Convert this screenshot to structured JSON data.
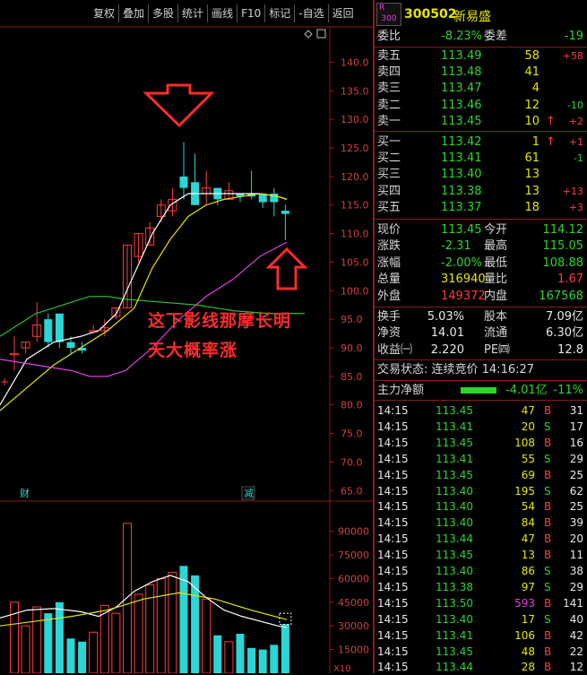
{
  "toolbar": {
    "items": [
      "复权",
      "叠加",
      "多股",
      "统计",
      "画线",
      "F10",
      "标记",
      "-自选",
      "返回"
    ]
  },
  "stock": {
    "badge_top": "R",
    "badge_bottom": "300",
    "code": "300502",
    "name": "新易盛"
  },
  "order_book": {
    "weibi_label": "委比",
    "weibi_value": "-8.23%",
    "weicha_label": "委差",
    "weicha_value": "-19",
    "sells": [
      {
        "label": "卖五",
        "price": "113.49",
        "vol": "58",
        "chg": "+58",
        "arrow": ""
      },
      {
        "label": "卖四",
        "price": "113.48",
        "vol": "41",
        "chg": "",
        "arrow": ""
      },
      {
        "label": "卖三",
        "price": "113.47",
        "vol": "4",
        "chg": "",
        "arrow": ""
      },
      {
        "label": "卖二",
        "price": "113.46",
        "vol": "12",
        "chg": "-10",
        "arrow": ""
      },
      {
        "label": "卖一",
        "price": "113.45",
        "vol": "10",
        "chg": "+2",
        "arrow": "↑"
      }
    ],
    "buys": [
      {
        "label": "买一",
        "price": "113.42",
        "vol": "1",
        "chg": "+1",
        "arrow": "↑"
      },
      {
        "label": "买二",
        "price": "113.41",
        "vol": "61",
        "chg": "-1",
        "arrow": ""
      },
      {
        "label": "买三",
        "price": "113.40",
        "vol": "13",
        "chg": "",
        "arrow": ""
      },
      {
        "label": "买四",
        "price": "113.38",
        "vol": "13",
        "chg": "+13",
        "arrow": ""
      },
      {
        "label": "买五",
        "price": "113.37",
        "vol": "18",
        "chg": "+3",
        "arrow": ""
      }
    ]
  },
  "quote": {
    "rows": [
      {
        "l1": "现价",
        "v1": "113.45",
        "c1": "gr",
        "l2": "今开",
        "v2": "114.12",
        "c2": "gr"
      },
      {
        "l1": "涨跌",
        "v1": "-2.31",
        "c1": "gr",
        "l2": "最高",
        "v2": "115.05",
        "c2": "gr"
      },
      {
        "l1": "涨幅",
        "v1": "-2.00%",
        "c1": "gr",
        "l2": "最低",
        "v2": "108.88",
        "c2": "gr"
      },
      {
        "l1": "总量",
        "v1": "316940",
        "c1": "yl",
        "l2": "量比",
        "v2": "1.67",
        "c2": "rd"
      },
      {
        "l1": "外盘",
        "v1": "149372",
        "c1": "rd",
        "l2": "内盘",
        "v2": "167568",
        "c2": "gr"
      }
    ],
    "rows2": [
      {
        "l1": "换手",
        "v1": "5.03%",
        "l2": "股本",
        "v2": "7.09亿"
      },
      {
        "l1": "净资",
        "v1": "14.01",
        "l2": "流通",
        "v2": "6.30亿"
      },
      {
        "l1": "收益㈠",
        "v1": "2.220",
        "l2": "PE㈣",
        "v2": "12.8"
      }
    ],
    "trade_status": "交易状态: 连续竞价 14:16:27",
    "main_flow_label": "主力净额",
    "main_flow_value": "-4.01亿",
    "main_flow_pct": "-11%"
  },
  "ticks": [
    {
      "t": "14:15",
      "p": "113.45",
      "pc": "gr",
      "v": "47",
      "vc": "yl",
      "s": "B",
      "n": "31"
    },
    {
      "t": "14:15",
      "p": "113.41",
      "pc": "gr",
      "v": "20",
      "vc": "yl",
      "s": "S",
      "n": "17"
    },
    {
      "t": "14:15",
      "p": "113.45",
      "pc": "gr",
      "v": "108",
      "vc": "yl",
      "s": "B",
      "n": "16"
    },
    {
      "t": "14:15",
      "p": "113.41",
      "pc": "gr",
      "v": "55",
      "vc": "yl",
      "s": "S",
      "n": "29"
    },
    {
      "t": "14:15",
      "p": "113.45",
      "pc": "gr",
      "v": "69",
      "vc": "yl",
      "s": "B",
      "n": "25"
    },
    {
      "t": "14:15",
      "p": "113.40",
      "pc": "gr",
      "v": "195",
      "vc": "yl",
      "s": "S",
      "n": "62"
    },
    {
      "t": "14:15",
      "p": "113.40",
      "pc": "gr",
      "v": "54",
      "vc": "yl",
      "s": "B",
      "n": "25"
    },
    {
      "t": "14:15",
      "p": "113.40",
      "pc": "gr",
      "v": "84",
      "vc": "yl",
      "s": "B",
      "n": "39"
    },
    {
      "t": "14:15",
      "p": "113.44",
      "pc": "gr",
      "v": "47",
      "vc": "yl",
      "s": "B",
      "n": "20"
    },
    {
      "t": "14:15",
      "p": "113.45",
      "pc": "gr",
      "v": "13",
      "vc": "yl",
      "s": "B",
      "n": "11"
    },
    {
      "t": "14:15",
      "p": "113.40",
      "pc": "gr",
      "v": "86",
      "vc": "yl",
      "s": "S",
      "n": "38"
    },
    {
      "t": "14:15",
      "p": "113.38",
      "pc": "gr",
      "v": "97",
      "vc": "yl",
      "s": "S",
      "n": "29"
    },
    {
      "t": "14:15",
      "p": "113.50",
      "pc": "gr",
      "v": "593",
      "vc": "mg",
      "s": "B",
      "n": "141"
    },
    {
      "t": "14:15",
      "p": "113.40",
      "pc": "gr",
      "v": "17",
      "vc": "yl",
      "s": "S",
      "n": "40"
    },
    {
      "t": "14:15",
      "p": "113.41",
      "pc": "gr",
      "v": "106",
      "vc": "yl",
      "s": "B",
      "n": "42"
    },
    {
      "t": "14:15",
      "p": "113.45",
      "pc": "gr",
      "v": "48",
      "vc": "yl",
      "s": "B",
      "n": "22"
    },
    {
      "t": "14:15",
      "p": "113.44",
      "pc": "gr",
      "v": "28",
      "vc": "yl",
      "s": "B",
      "n": "12"
    }
  ],
  "chart": {
    "price_axis": [
      "140.0",
      "135.0",
      "130.0",
      "125.0",
      "120.0",
      "115.0",
      "110.0",
      "105.0",
      "100.0",
      "95.0",
      "90.0",
      "85.0",
      "80.0",
      "75.0",
      "70.0",
      "65.0"
    ],
    "vol_axis": [
      "90000",
      "75000",
      "60000",
      "45000",
      "30000",
      "15000"
    ],
    "vol_axis_unit": "X10",
    "markers": [
      {
        "text": "财"
      },
      {
        "text": "减"
      }
    ],
    "annotation_lines": [
      "这下影线那摩长明",
      "天大概率涨"
    ]
  },
  "chart_data": {
    "type": "candlestick",
    "price_range": [
      63,
      144
    ],
    "candles": [
      {
        "o": 89,
        "c": 89,
        "h": 92,
        "l": 86
      },
      {
        "o": 90,
        "c": 91,
        "h": 91,
        "l": 89
      },
      {
        "o": 92,
        "c": 94,
        "h": 98,
        "l": 91
      },
      {
        "o": 95,
        "c": 91,
        "h": 96,
        "l": 90
      },
      {
        "o": 96,
        "c": 91,
        "h": 96,
        "l": 90
      },
      {
        "o": 91,
        "c": 90,
        "h": 92,
        "l": 89
      },
      {
        "o": 90,
        "c": 89.5,
        "h": 91,
        "l": 89
      },
      {
        "o": 93,
        "c": 93,
        "h": 94,
        "l": 93
      },
      {
        "o": 93,
        "c": 93.5,
        "h": 95,
        "l": 92
      },
      {
        "o": 95.5,
        "c": 97,
        "h": 97,
        "l": 95
      },
      {
        "o": 97,
        "c": 108,
        "h": 108,
        "l": 97
      },
      {
        "o": 106,
        "c": 110,
        "h": 110,
        "l": 105
      },
      {
        "o": 108,
        "c": 111,
        "h": 112,
        "l": 108
      },
      {
        "o": 113,
        "c": 115,
        "h": 116,
        "l": 112
      },
      {
        "o": 114,
        "c": 116,
        "h": 118,
        "l": 113
      },
      {
        "o": 120,
        "c": 118,
        "h": 126,
        "l": 116
      },
      {
        "o": 119,
        "c": 115,
        "h": 124,
        "l": 115
      },
      {
        "o": 117,
        "c": 118,
        "h": 121,
        "l": 115
      },
      {
        "o": 118,
        "c": 116,
        "h": 118,
        "l": 115
      },
      {
        "o": 116,
        "c": 117.5,
        "h": 119,
        "l": 116
      },
      {
        "o": 117,
        "c": 116.5,
        "h": 117,
        "l": 115.5
      },
      {
        "o": 117,
        "c": 116.5,
        "h": 121,
        "l": 116
      },
      {
        "o": 117,
        "c": 115.5,
        "h": 117,
        "l": 114.5
      },
      {
        "o": 117,
        "c": 115.5,
        "h": 118,
        "l": 113
      },
      {
        "o": 114,
        "c": 113.45,
        "h": 115.05,
        "l": 108.88
      }
    ],
    "volume_range": [
      0,
      100000
    ],
    "volumes": [
      45000,
      30000,
      42000,
      38000,
      45000,
      22000,
      20000,
      26000,
      43000,
      38000,
      95000,
      50000,
      56000,
      60000,
      64000,
      68000,
      62000,
      47000,
      24000,
      20000,
      25000,
      16000,
      15000,
      18000,
      31000
    ]
  }
}
